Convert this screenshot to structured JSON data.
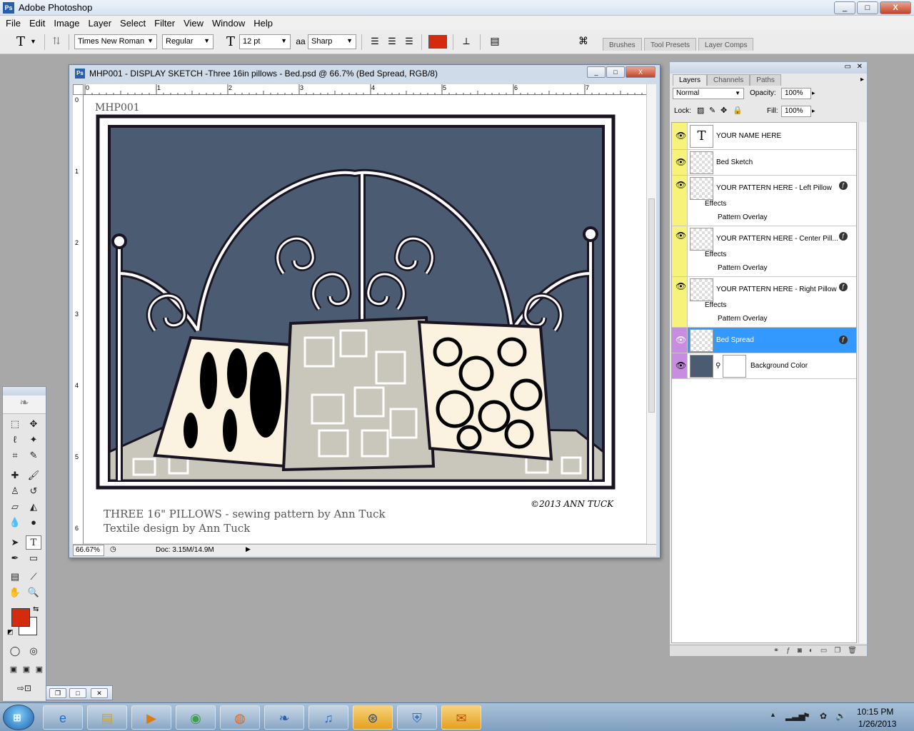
{
  "app": {
    "title": "Adobe Photoshop",
    "badge": "Ps",
    "window_buttons": {
      "minimize": "_",
      "maximize": "□",
      "close": "X"
    }
  },
  "menu": [
    "File",
    "Edit",
    "Image",
    "Layer",
    "Select",
    "Filter",
    "View",
    "Window",
    "Help"
  ],
  "options_bar": {
    "tool_icon": "T",
    "font_family": "Times New Roman",
    "font_style": "Regular",
    "font_size": "12 pt",
    "anti_alias_icon": "aa",
    "anti_alias": "Sharp",
    "text_color": "#d42a0e",
    "panel_tabs": [
      "Brushes",
      "Tool Presets",
      "Layer Comps"
    ]
  },
  "document": {
    "title": "MHP001 - DISPLAY SKETCH -Three 16in pillows - Bed.psd @ 66.7% (Bed Spread, RGB/8)",
    "ruler_h": [
      "0",
      "1",
      "2",
      "3",
      "4",
      "5",
      "6",
      "7"
    ],
    "ruler_v": [
      "0",
      "1",
      "2",
      "3",
      "4",
      "5",
      "6"
    ],
    "canvas_code": "MHP001",
    "caption_title": "THREE 16\" PILLOWS - sewing pattern by Ann Tuck",
    "caption_design": "Textile design by Ann Tuck",
    "signature": "©2013 ANN TUCK",
    "colors": {
      "wall": "#4b5b72",
      "spread": "#c9c6bb",
      "outline": "#1a1422"
    },
    "status": {
      "zoom": "66.67%",
      "doc": "Doc: 3.15M/14.9M"
    }
  },
  "layers_panel": {
    "tabs": [
      "Layers",
      "Channels",
      "Paths"
    ],
    "blend_mode": "Normal",
    "opacity_label": "Opacity:",
    "opacity": "100%",
    "lock_label": "Lock:",
    "fill_label": "Fill:",
    "fill": "100%",
    "layers": [
      {
        "name": "YOUR NAME HERE",
        "thumb": "T"
      },
      {
        "name": "Bed Sketch"
      },
      {
        "name": "YOUR PATTERN HERE - Left Pillow",
        "effects": "Effects",
        "overlay": "Pattern Overlay"
      },
      {
        "name": "YOUR PATTERN HERE - Center Pill...",
        "effects": "Effects",
        "overlay": "Pattern Overlay"
      },
      {
        "name": "YOUR PATTERN HERE - Right Pillow",
        "effects": "Effects",
        "overlay": "Pattern Overlay"
      },
      {
        "name": "Bed Spread"
      },
      {
        "name": "Background Color"
      }
    ],
    "selected_layer": "Bed Spread"
  },
  "toolbox": {
    "fg_color": "#d42a0e",
    "bg_color": "#ffffff"
  },
  "taskbar": {
    "time": "10:15 PM",
    "date": "1/26/2013",
    "apps": [
      "internet-explorer-icon",
      "file-explorer-icon",
      "media-player-icon",
      "chrome-icon",
      "firefox-icon",
      "photoshop-icon",
      "itunes-icon",
      "network-icon",
      "security-icon",
      "outlook-icon"
    ]
  }
}
